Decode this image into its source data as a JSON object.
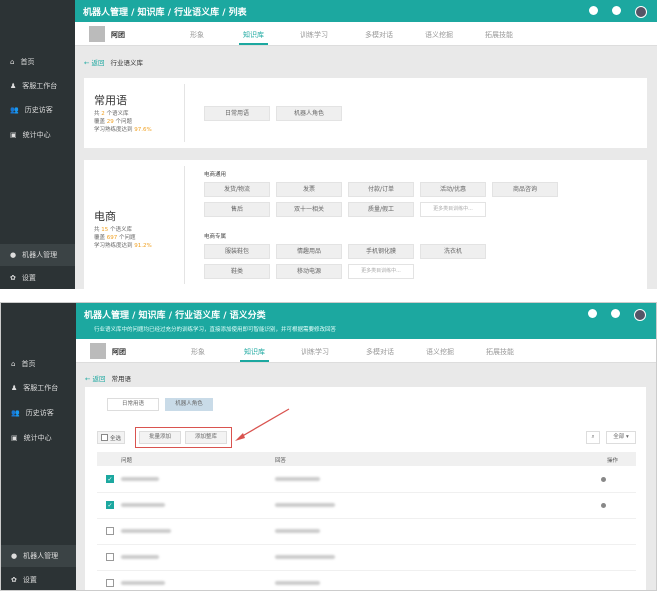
{
  "accent": "#1ca8a0",
  "sidebar": {
    "items": [
      {
        "label": "首页",
        "icon": "home-icon"
      },
      {
        "label": "客服工作台",
        "icon": "agent-icon"
      },
      {
        "label": "历史访客",
        "icon": "users-icon"
      },
      {
        "label": "统计中心",
        "icon": "chart-icon"
      },
      {
        "label": "机器人管理",
        "icon": "robot-icon"
      },
      {
        "label": "设置",
        "icon": "gear-icon"
      }
    ]
  },
  "robot": {
    "name": "阿团"
  },
  "nav": [
    "形象",
    "知识库",
    "训练学习",
    "多模对话",
    "语义挖掘",
    "拓展技能"
  ],
  "screen1": {
    "breadcrumb": "机器人管理 / 知识库 / 行业语义库 / 列表",
    "back": "← 返回",
    "page": "行业语义库",
    "cards": [
      {
        "title": "常用语",
        "stats": {
          "libs": "2",
          "questions": "29",
          "mastery": "97.6%"
        },
        "tags": [
          "日常用语",
          "机器人角色"
        ]
      },
      {
        "title": "电商",
        "stats": {
          "libs": "15",
          "questions": "697",
          "mastery": "91.2%"
        },
        "groups": [
          {
            "label": "电商通用",
            "tags": [
              "发货/物流",
              "发票",
              "付款/订单",
              "活动/优惠",
              "商品咨询",
              "售后",
              "双十一相关",
              "质量/假工"
            ],
            "more": "更多类目训练中..."
          },
          {
            "label": "电商专属",
            "tags": [
              "服装鞋包",
              "情趣用品",
              "手机钢化膜",
              "洗衣机",
              "鞋类",
              "移动电源"
            ],
            "more": "更多类目训练中..."
          }
        ]
      }
    ],
    "stat_labels": {
      "libs_pre": "共 ",
      "libs_post": " 个语义库",
      "q_pre": "覆盖 ",
      "q_post": " 个问题",
      "m_pre": "学习熟练度达到 "
    }
  },
  "screen2": {
    "breadcrumb": "机器人管理 / 知识库 / 行业语义库 / 语义分类",
    "hint": "行业语义库中的问题均已经过充分的训练学习，直接添加使用即可智能识别，并可根据需要修改回答",
    "back": "← 返回",
    "page": "常用语",
    "tabs": [
      "日常用语",
      "机器人角色"
    ],
    "select_all": "全选",
    "batch_add": "批量添加",
    "add_all": "添加整库",
    "filter": "全部 ▾",
    "columns": [
      "问题",
      "回答",
      "操作"
    ],
    "rows": [
      {
        "checked": true
      },
      {
        "checked": true
      },
      {
        "checked": false
      },
      {
        "checked": false
      },
      {
        "checked": false
      }
    ]
  }
}
